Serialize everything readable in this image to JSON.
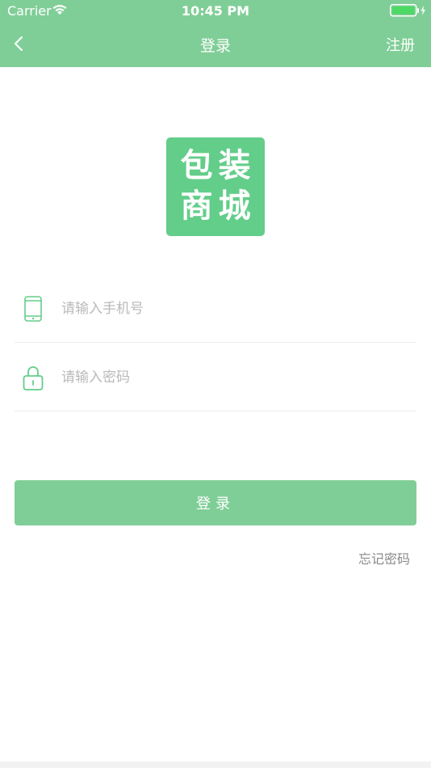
{
  "status_bar": {
    "carrier": "Carrier",
    "time": "10:45 PM"
  },
  "nav": {
    "title": "登录",
    "register_label": "注册",
    "back_icon": "chevron-left-icon"
  },
  "logo": {
    "chars": [
      "包",
      "装",
      "商",
      "城"
    ]
  },
  "form": {
    "phone_placeholder": "请输入手机号",
    "phone_value": "",
    "password_placeholder": "请输入密码",
    "password_value": "",
    "phone_icon": "phone-icon",
    "password_icon": "lock-icon",
    "login_label": "登录",
    "forgot_label": "忘记密码"
  },
  "colors": {
    "accent": "#80ce97",
    "logo_bg": "#63cd8a",
    "placeholder": "#b9b9b9",
    "link_gray": "#8a8a8a",
    "divider": "#ececec"
  }
}
